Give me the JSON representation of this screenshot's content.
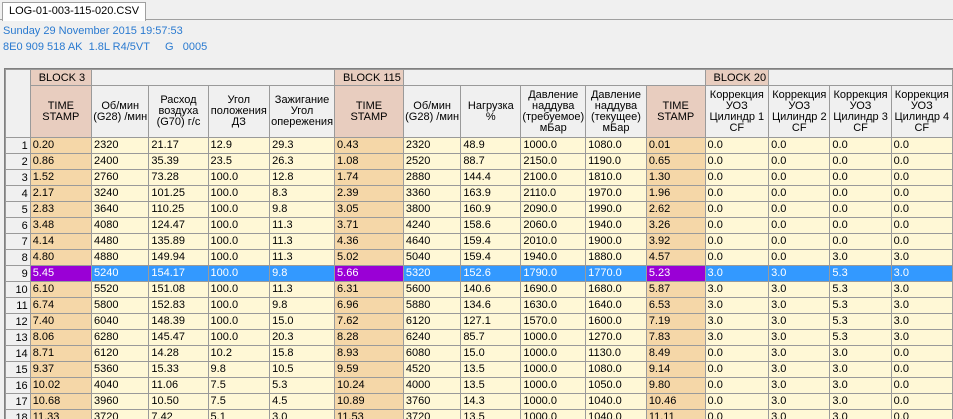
{
  "tab": {
    "label": "LOG-01-003-115-020.CSV"
  },
  "info": {
    "line1": "Sunday 29 November 2015 19:57:53",
    "line2": "8E0 909 518 AK  1.8L R4/5VT     G   0005"
  },
  "blocks": [
    {
      "label": "BLOCK 3",
      "span": 5
    },
    {
      "label": "BLOCK 115",
      "span": 6
    },
    {
      "label": "BLOCK 20",
      "span": 5
    }
  ],
  "headers": [
    {
      "label": "TIME STAMP",
      "ts": true
    },
    {
      "label": "Об/мин (G28) /мин"
    },
    {
      "label": "Расход воздуха (G70) г/с"
    },
    {
      "label": "Угол положения ДЗ"
    },
    {
      "label": "Зажигание Угол опережения"
    },
    {
      "label": "TIME STAMP",
      "ts": true
    },
    {
      "label": "Об/мин (G28) /мин"
    },
    {
      "label": "Нагрузка %"
    },
    {
      "label": "Давление наддува (требуемое) мБар"
    },
    {
      "label": "Давление наддува (текущее) мБар"
    },
    {
      "label": "TIME STAMP",
      "ts": true
    },
    {
      "label": "Коррекция УОЗ Цилиндр 1 CF"
    },
    {
      "label": "Коррекция УОЗ Цилиндр 2 CF"
    },
    {
      "label": "Коррекция УОЗ Цилиндр 3 CF"
    },
    {
      "label": "Коррекция УОЗ Цилиндр 4 CF"
    }
  ],
  "selected_row": 9,
  "rows": [
    [
      "1",
      "0.20",
      "2320",
      "21.17",
      "12.9",
      "29.3",
      "0.43",
      "2320",
      "48.9",
      "1000.0",
      "1080.0",
      "0.01",
      "0.0",
      "0.0",
      "0.0",
      "0.0"
    ],
    [
      "2",
      "0.86",
      "2400",
      "35.39",
      "23.5",
      "26.3",
      "1.08",
      "2520",
      "88.7",
      "2150.0",
      "1190.0",
      "0.65",
      "0.0",
      "0.0",
      "0.0",
      "0.0"
    ],
    [
      "3",
      "1.52",
      "2760",
      "73.28",
      "100.0",
      "12.8",
      "1.74",
      "2880",
      "144.4",
      "2100.0",
      "1810.0",
      "1.30",
      "0.0",
      "0.0",
      "0.0",
      "0.0"
    ],
    [
      "4",
      "2.17",
      "3240",
      "101.25",
      "100.0",
      "8.3",
      "2.39",
      "3360",
      "163.9",
      "2110.0",
      "1970.0",
      "1.96",
      "0.0",
      "0.0",
      "0.0",
      "0.0"
    ],
    [
      "5",
      "2.83",
      "3640",
      "110.25",
      "100.0",
      "9.8",
      "3.05",
      "3800",
      "160.9",
      "2090.0",
      "1990.0",
      "2.62",
      "0.0",
      "0.0",
      "0.0",
      "0.0"
    ],
    [
      "6",
      "3.48",
      "4080",
      "124.47",
      "100.0",
      "11.3",
      "3.71",
      "4240",
      "158.6",
      "2060.0",
      "1940.0",
      "3.26",
      "0.0",
      "0.0",
      "0.0",
      "0.0"
    ],
    [
      "7",
      "4.14",
      "4480",
      "135.89",
      "100.0",
      "11.3",
      "4.36",
      "4640",
      "159.4",
      "2010.0",
      "1900.0",
      "3.92",
      "0.0",
      "0.0",
      "0.0",
      "0.0"
    ],
    [
      "8",
      "4.80",
      "4880",
      "149.94",
      "100.0",
      "11.3",
      "5.02",
      "5040",
      "159.4",
      "1940.0",
      "1880.0",
      "4.57",
      "0.0",
      "0.0",
      "3.0",
      "3.0"
    ],
    [
      "9",
      "5.45",
      "5240",
      "154.17",
      "100.0",
      "9.8",
      "5.66",
      "5320",
      "152.6",
      "1790.0",
      "1770.0",
      "5.23",
      "3.0",
      "3.0",
      "5.3",
      "3.0"
    ],
    [
      "10",
      "6.10",
      "5520",
      "151.08",
      "100.0",
      "11.3",
      "6.31",
      "5600",
      "140.6",
      "1690.0",
      "1680.0",
      "5.87",
      "3.0",
      "3.0",
      "5.3",
      "3.0"
    ],
    [
      "11",
      "6.74",
      "5800",
      "152.83",
      "100.0",
      "9.8",
      "6.96",
      "5880",
      "134.6",
      "1630.0",
      "1640.0",
      "6.53",
      "3.0",
      "3.0",
      "5.3",
      "3.0"
    ],
    [
      "12",
      "7.40",
      "6040",
      "148.39",
      "100.0",
      "15.0",
      "7.62",
      "6120",
      "127.1",
      "1570.0",
      "1600.0",
      "7.19",
      "3.0",
      "3.0",
      "5.3",
      "3.0"
    ],
    [
      "13",
      "8.06",
      "6280",
      "145.47",
      "100.0",
      "20.3",
      "8.28",
      "6240",
      "85.7",
      "1000.0",
      "1270.0",
      "7.83",
      "3.0",
      "3.0",
      "5.3",
      "3.0"
    ],
    [
      "14",
      "8.71",
      "6120",
      "14.28",
      "10.2",
      "15.8",
      "8.93",
      "6080",
      "15.0",
      "1000.0",
      "1130.0",
      "8.49",
      "0.0",
      "3.0",
      "3.0",
      "0.0"
    ],
    [
      "15",
      "9.37",
      "5360",
      "15.33",
      "9.8",
      "10.5",
      "9.59",
      "4520",
      "13.5",
      "1000.0",
      "1080.0",
      "9.14",
      "0.0",
      "3.0",
      "3.0",
      "0.0"
    ],
    [
      "16",
      "10.02",
      "4040",
      "11.06",
      "7.5",
      "5.3",
      "10.24",
      "4000",
      "13.5",
      "1000.0",
      "1050.0",
      "9.80",
      "0.0",
      "3.0",
      "3.0",
      "0.0"
    ],
    [
      "17",
      "10.68",
      "3960",
      "10.50",
      "7.5",
      "4.5",
      "10.89",
      "3760",
      "14.3",
      "1000.0",
      "1040.0",
      "10.46",
      "0.0",
      "3.0",
      "3.0",
      "0.0"
    ],
    [
      "18",
      "11.33",
      "3720",
      "7.42",
      "5.1",
      "3.0",
      "11.53",
      "3720",
      "13.5",
      "1000.0",
      "1040.0",
      "11.11",
      "0.0",
      "3.0",
      "3.0",
      "0.0"
    ]
  ]
}
